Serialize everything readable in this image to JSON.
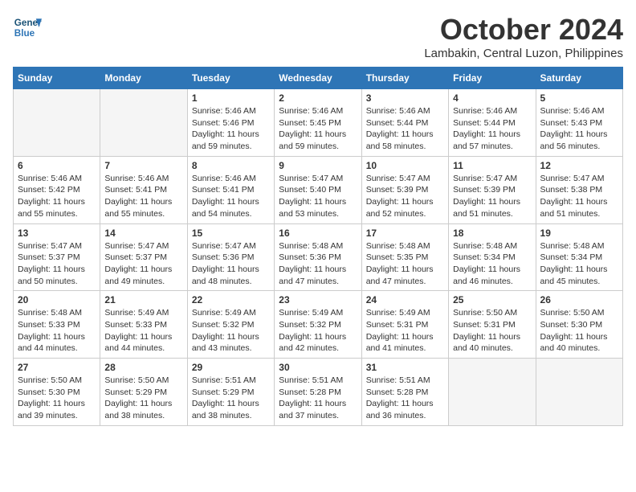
{
  "header": {
    "logo_line1": "General",
    "logo_line2": "Blue",
    "month": "October 2024",
    "location": "Lambakin, Central Luzon, Philippines"
  },
  "days_of_week": [
    "Sunday",
    "Monday",
    "Tuesday",
    "Wednesday",
    "Thursday",
    "Friday",
    "Saturday"
  ],
  "weeks": [
    [
      {
        "day": "",
        "info": ""
      },
      {
        "day": "",
        "info": ""
      },
      {
        "day": "1",
        "info": "Sunrise: 5:46 AM\nSunset: 5:46 PM\nDaylight: 11 hours and 59 minutes."
      },
      {
        "day": "2",
        "info": "Sunrise: 5:46 AM\nSunset: 5:45 PM\nDaylight: 11 hours and 59 minutes."
      },
      {
        "day": "3",
        "info": "Sunrise: 5:46 AM\nSunset: 5:44 PM\nDaylight: 11 hours and 58 minutes."
      },
      {
        "day": "4",
        "info": "Sunrise: 5:46 AM\nSunset: 5:44 PM\nDaylight: 11 hours and 57 minutes."
      },
      {
        "day": "5",
        "info": "Sunrise: 5:46 AM\nSunset: 5:43 PM\nDaylight: 11 hours and 56 minutes."
      }
    ],
    [
      {
        "day": "6",
        "info": "Sunrise: 5:46 AM\nSunset: 5:42 PM\nDaylight: 11 hours and 55 minutes."
      },
      {
        "day": "7",
        "info": "Sunrise: 5:46 AM\nSunset: 5:41 PM\nDaylight: 11 hours and 55 minutes."
      },
      {
        "day": "8",
        "info": "Sunrise: 5:46 AM\nSunset: 5:41 PM\nDaylight: 11 hours and 54 minutes."
      },
      {
        "day": "9",
        "info": "Sunrise: 5:47 AM\nSunset: 5:40 PM\nDaylight: 11 hours and 53 minutes."
      },
      {
        "day": "10",
        "info": "Sunrise: 5:47 AM\nSunset: 5:39 PM\nDaylight: 11 hours and 52 minutes."
      },
      {
        "day": "11",
        "info": "Sunrise: 5:47 AM\nSunset: 5:39 PM\nDaylight: 11 hours and 51 minutes."
      },
      {
        "day": "12",
        "info": "Sunrise: 5:47 AM\nSunset: 5:38 PM\nDaylight: 11 hours and 51 minutes."
      }
    ],
    [
      {
        "day": "13",
        "info": "Sunrise: 5:47 AM\nSunset: 5:37 PM\nDaylight: 11 hours and 50 minutes."
      },
      {
        "day": "14",
        "info": "Sunrise: 5:47 AM\nSunset: 5:37 PM\nDaylight: 11 hours and 49 minutes."
      },
      {
        "day": "15",
        "info": "Sunrise: 5:47 AM\nSunset: 5:36 PM\nDaylight: 11 hours and 48 minutes."
      },
      {
        "day": "16",
        "info": "Sunrise: 5:48 AM\nSunset: 5:36 PM\nDaylight: 11 hours and 47 minutes."
      },
      {
        "day": "17",
        "info": "Sunrise: 5:48 AM\nSunset: 5:35 PM\nDaylight: 11 hours and 47 minutes."
      },
      {
        "day": "18",
        "info": "Sunrise: 5:48 AM\nSunset: 5:34 PM\nDaylight: 11 hours and 46 minutes."
      },
      {
        "day": "19",
        "info": "Sunrise: 5:48 AM\nSunset: 5:34 PM\nDaylight: 11 hours and 45 minutes."
      }
    ],
    [
      {
        "day": "20",
        "info": "Sunrise: 5:48 AM\nSunset: 5:33 PM\nDaylight: 11 hours and 44 minutes."
      },
      {
        "day": "21",
        "info": "Sunrise: 5:49 AM\nSunset: 5:33 PM\nDaylight: 11 hours and 44 minutes."
      },
      {
        "day": "22",
        "info": "Sunrise: 5:49 AM\nSunset: 5:32 PM\nDaylight: 11 hours and 43 minutes."
      },
      {
        "day": "23",
        "info": "Sunrise: 5:49 AM\nSunset: 5:32 PM\nDaylight: 11 hours and 42 minutes."
      },
      {
        "day": "24",
        "info": "Sunrise: 5:49 AM\nSunset: 5:31 PM\nDaylight: 11 hours and 41 minutes."
      },
      {
        "day": "25",
        "info": "Sunrise: 5:50 AM\nSunset: 5:31 PM\nDaylight: 11 hours and 40 minutes."
      },
      {
        "day": "26",
        "info": "Sunrise: 5:50 AM\nSunset: 5:30 PM\nDaylight: 11 hours and 40 minutes."
      }
    ],
    [
      {
        "day": "27",
        "info": "Sunrise: 5:50 AM\nSunset: 5:30 PM\nDaylight: 11 hours and 39 minutes."
      },
      {
        "day": "28",
        "info": "Sunrise: 5:50 AM\nSunset: 5:29 PM\nDaylight: 11 hours and 38 minutes."
      },
      {
        "day": "29",
        "info": "Sunrise: 5:51 AM\nSunset: 5:29 PM\nDaylight: 11 hours and 38 minutes."
      },
      {
        "day": "30",
        "info": "Sunrise: 5:51 AM\nSunset: 5:28 PM\nDaylight: 11 hours and 37 minutes."
      },
      {
        "day": "31",
        "info": "Sunrise: 5:51 AM\nSunset: 5:28 PM\nDaylight: 11 hours and 36 minutes."
      },
      {
        "day": "",
        "info": ""
      },
      {
        "day": "",
        "info": ""
      }
    ]
  ]
}
